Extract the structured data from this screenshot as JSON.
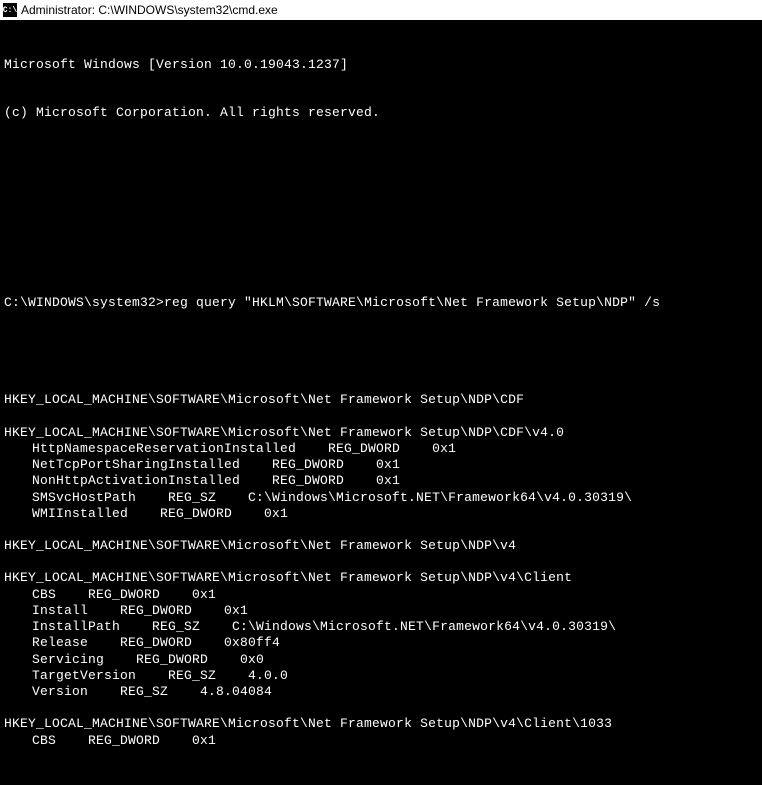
{
  "title_bar": {
    "icon_text": "C:\\",
    "text": "Administrator: C:\\WINDOWS\\system32\\cmd.exe"
  },
  "header": {
    "line1": "Microsoft Windows [Version 10.0.19043.1237]",
    "line2": "(c) Microsoft Corporation. All rights reserved."
  },
  "prompt": {
    "path": "C:\\WINDOWS\\system32>",
    "command": "reg query \"HKLM\\SOFTWARE\\Microsoft\\Net Framework Setup\\NDP\" /s"
  },
  "keys": [
    {
      "path": "HKEY_LOCAL_MACHINE\\SOFTWARE\\Microsoft\\Net Framework Setup\\NDP\\CDF",
      "values": []
    },
    {
      "path": "HKEY_LOCAL_MACHINE\\SOFTWARE\\Microsoft\\Net Framework Setup\\NDP\\CDF\\v4.0",
      "values": [
        "HttpNamespaceReservationInstalled    REG_DWORD    0x1",
        "NetTcpPortSharingInstalled    REG_DWORD    0x1",
        "NonHttpActivationInstalled    REG_DWORD    0x1",
        "SMSvcHostPath    REG_SZ    C:\\Windows\\Microsoft.NET\\Framework64\\v4.0.30319\\",
        "WMIInstalled    REG_DWORD    0x1"
      ]
    },
    {
      "path": "HKEY_LOCAL_MACHINE\\SOFTWARE\\Microsoft\\Net Framework Setup\\NDP\\v4",
      "values": []
    },
    {
      "path": "HKEY_LOCAL_MACHINE\\SOFTWARE\\Microsoft\\Net Framework Setup\\NDP\\v4\\Client",
      "values": [
        "CBS    REG_DWORD    0x1",
        "Install    REG_DWORD    0x1",
        "InstallPath    REG_SZ    C:\\Windows\\Microsoft.NET\\Framework64\\v4.0.30319\\",
        "Release    REG_DWORD    0x80ff4",
        "Servicing    REG_DWORD    0x0",
        "TargetVersion    REG_SZ    4.0.0",
        "Version    REG_SZ    4.8.04084"
      ]
    },
    {
      "path": "HKEY_LOCAL_MACHINE\\SOFTWARE\\Microsoft\\Net Framework Setup\\NDP\\v4\\Client\\1033",
      "values": [
        "CBS    REG_DWORD    0x1"
      ]
    }
  ]
}
